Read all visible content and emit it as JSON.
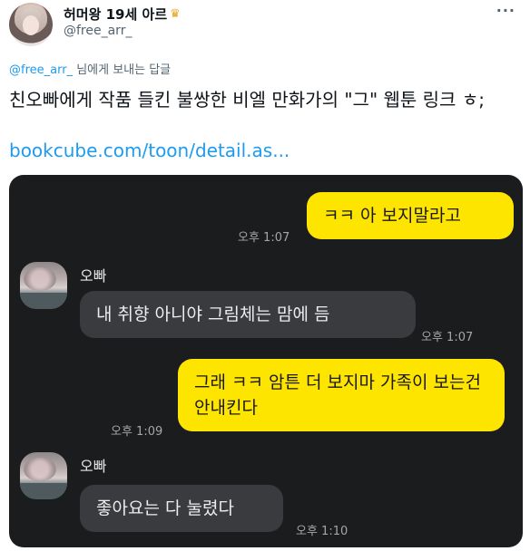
{
  "tweet": {
    "display_name": "허머왕 19세 아르",
    "crown_icon": "crown-icon",
    "handle": "@free_arr_",
    "more_label": "···",
    "reply_mention": "@free_arr_",
    "reply_suffix": " 님에게 보내는 답글",
    "text": "친오빠에게 작품 들킨 불쌍한 비엘 만화가의 \"그\" 웹툰 링크 ㅎ;",
    "link": "bookcube.com/toon/detail.as..."
  },
  "chat": {
    "messages": [
      {
        "text": "ㅋㅋ 아 보지말라고",
        "time": "오후 1:07"
      },
      {
        "sender": "오빠",
        "text": "내 취향 아니야  그림체는 맘에 듬",
        "time": "오후 1:07"
      },
      {
        "text": "그래 ㅋㅋ 암튼 더 보지마 가족이 보는건 안내킨다",
        "time": "오후 1:09"
      },
      {
        "sender": "오빠",
        "text": "좋아요는 다 눌렸다",
        "time": "오후 1:10"
      }
    ]
  },
  "colors": {
    "mention_blue": "#1d9bf0",
    "kakao_yellow": "#fee500",
    "chat_bg": "#1b1c1e",
    "incoming_bubble": "#3a3b3e"
  }
}
